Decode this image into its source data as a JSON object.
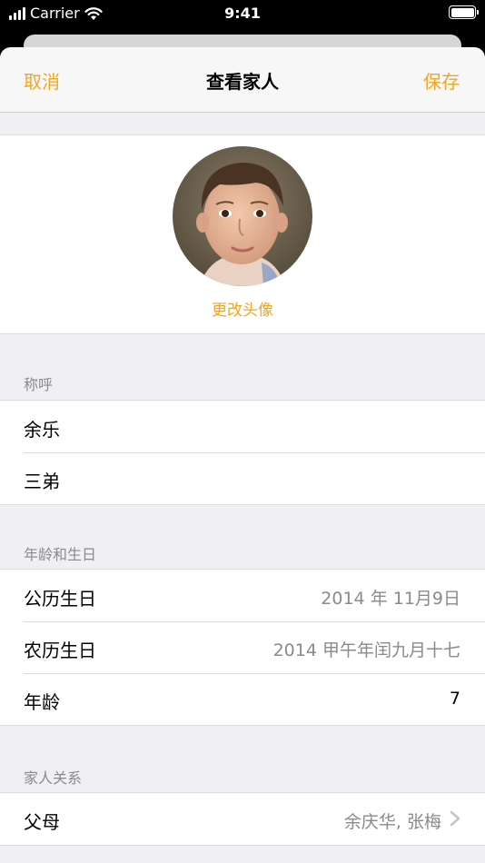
{
  "status_bar": {
    "carrier": "Carrier",
    "time": "9:41"
  },
  "nav": {
    "cancel": "取消",
    "title": "查看家人",
    "save": "保存",
    "accent_color": "#f3a521"
  },
  "avatar": {
    "change_label": "更改头像"
  },
  "sections": {
    "names": {
      "header": "称呼",
      "rows": [
        "余乐",
        "三弟"
      ]
    },
    "age": {
      "header": "年龄和生日",
      "rows": [
        {
          "label": "公历生日",
          "value": "2014 年 11月9日"
        },
        {
          "label": "农历生日",
          "value": "2014 甲午年闰九月十七"
        },
        {
          "label": "年龄",
          "value": "7"
        }
      ]
    },
    "family": {
      "header": "家人关系",
      "rows": [
        {
          "label": "父母",
          "value": "余庆华, 张梅"
        }
      ]
    }
  }
}
